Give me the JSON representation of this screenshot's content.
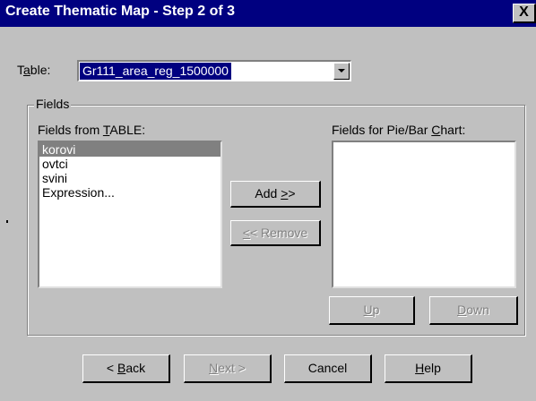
{
  "title": "Create Thematic Map - Step 2 of 3",
  "close_symbol": "X",
  "table": {
    "label_pre": "T",
    "label_accel": "a",
    "label_post": "ble:",
    "value": "Gr111_area_reg_1500000"
  },
  "fields_group": {
    "label": "Fields"
  },
  "from_table": {
    "label_pre": "Fields from ",
    "label_accel": "T",
    "label_post": "ABLE:"
  },
  "source_items": [
    "korovi",
    "ovtci",
    "svini",
    "Expression..."
  ],
  "selected_index": 0,
  "chart_fields": {
    "label_pre": "Fields for Pie/Bar ",
    "label_accel": "C",
    "label_post": "hart:"
  },
  "buttons": {
    "add": {
      "pre": "Add ",
      "accel": ">",
      "post": ">"
    },
    "remove": {
      "pre": "",
      "accel": "<",
      "post": "< Remove"
    },
    "up": {
      "pre": "",
      "accel": "U",
      "post": "p"
    },
    "down": {
      "pre": "",
      "accel": "D",
      "post": "own"
    },
    "back": {
      "pre": "< ",
      "accel": "B",
      "post": "ack"
    },
    "next": {
      "pre": "",
      "accel": "N",
      "post": "ext >"
    },
    "cancel": {
      "pre": "Cancel",
      "accel": "",
      "post": ""
    },
    "help": {
      "pre": "",
      "accel": "H",
      "post": "elp"
    }
  },
  "colors": {
    "titlebar": "#000080",
    "face": "#c0c0c0",
    "selection": "#808080"
  }
}
